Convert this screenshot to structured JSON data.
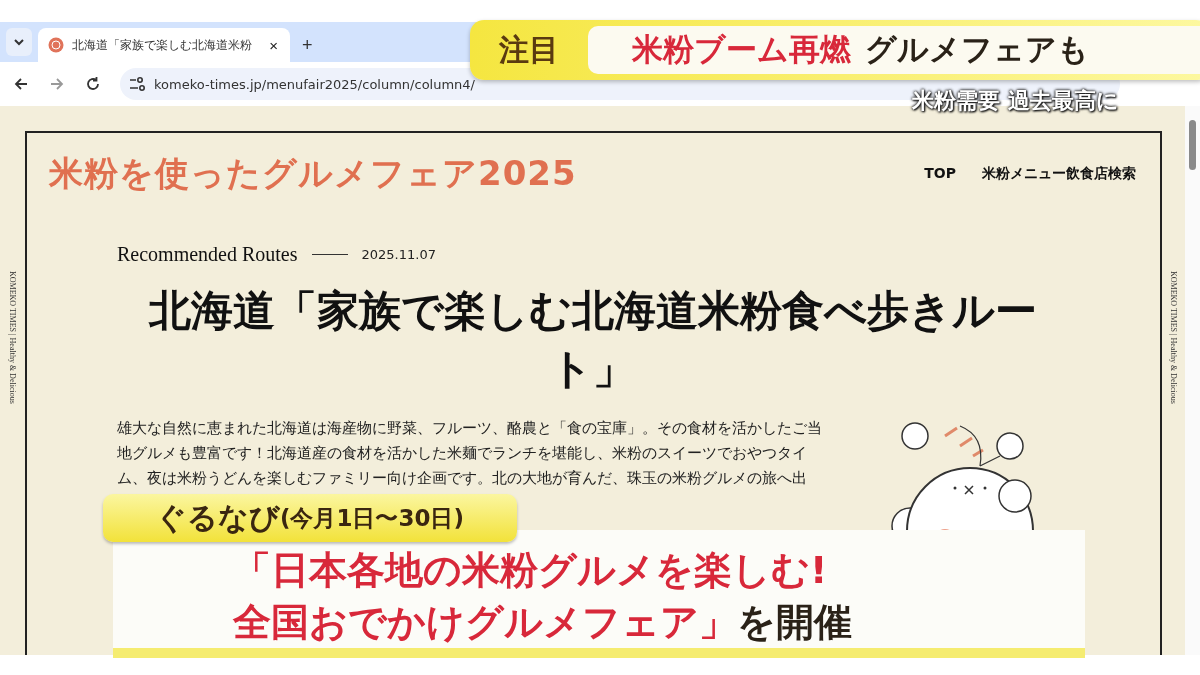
{
  "browser": {
    "tab": {
      "title": "北海道「家族で楽しむ北海道米粉",
      "close": "×",
      "selected": true
    },
    "new_tab": "+",
    "url": "komeko-times.jp/menufair2025/column/column4/"
  },
  "site": {
    "logo": "米粉を使ったグルメフェア2025",
    "nav": [
      {
        "label": "TOP"
      },
      {
        "label": "米粉メニュー飲食店検索"
      }
    ],
    "side_text": [
      "KOMEKO TIMES | Healthy & Delicious",
      "KOMEKO TIMES | Healthy & Delicious"
    ]
  },
  "article": {
    "category": "Recommended Routes",
    "date": "2025.11.07",
    "title": "北海道「家族で楽しむ北海道米粉食べ歩きルート」",
    "body": "雄大な自然に恵まれた北海道は海産物に野菜、フルーツ、酪農と「食の宝庫」。その食材を活かしたご当地グルメも豊富です！北海道産の食材を活かした米麺でランチを堪能し、米粉のスイーツでおやつタイム、夜は米粉うどんを楽しむファミリー向け企画です。北の大地が育んだ、珠玉の米粉グルメの旅へ出"
  },
  "captions": {
    "tag": "注目",
    "headline": [
      {
        "text": "米粉ブーム再燃",
        "kind": "highlight"
      },
      {
        "text": "グルメフェアも",
        "kind": "plain"
      }
    ],
    "sub": "米粉需要 過去最高に",
    "source": "ぐるなび",
    "period": "(今月1日〜30日)",
    "lines": [
      [
        {
          "text": "「日本各地の米粉グルメを楽しむ!",
          "kind": "highlight"
        }
      ],
      [
        {
          "text": "全国おでかけグルメフェア」",
          "kind": "highlight"
        },
        {
          "text": "を開催",
          "kind": "plain"
        }
      ]
    ]
  }
}
